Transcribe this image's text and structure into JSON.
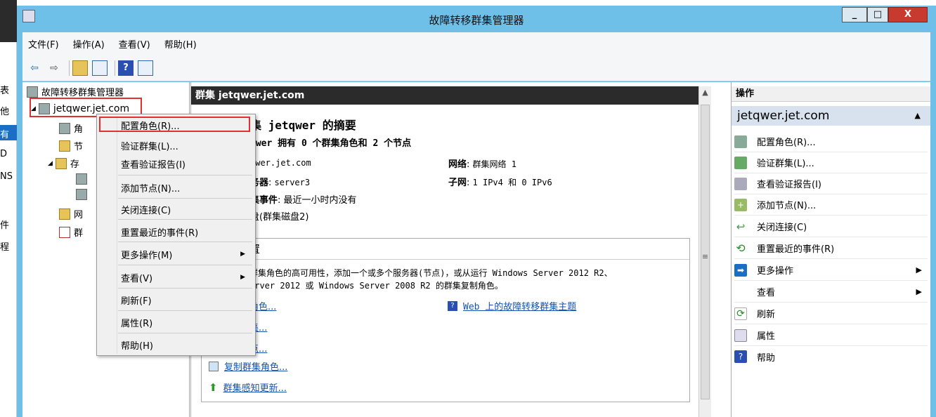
{
  "background": {
    "fragments": [
      "表",
      "他",
      "有",
      "D",
      "NS",
      "件",
      "程"
    ]
  },
  "window": {
    "title": "故障转移群集管理器",
    "min": "_",
    "max": "□",
    "close": "X"
  },
  "menu": [
    "文件(F)",
    "操作(A)",
    "查看(V)",
    "帮助(H)"
  ],
  "toolbar": {
    "back": "⇦",
    "forward": "⇨",
    "help": "?"
  },
  "tree": {
    "root": "故障转移群集管理器",
    "cluster": "jetqwer.jet.com",
    "children": [
      "角",
      "节",
      "存",
      "网",
      "群"
    ]
  },
  "center": {
    "header": "群集 jetqwer.jet.com",
    "summary_title": "集 jetqwer 的摘要",
    "summary_sub": "qwer 拥有 0 个群集角色和 2 个节点",
    "name_val": "qwer.jet.com",
    "server_key": "务器",
    "server_val": "server3",
    "network_key": "网络",
    "network_val": "群集网络 1",
    "subnet_key": "子网",
    "subnet_val": "1 IPv4 和 0 IPv6",
    "events_key": "集事件",
    "events_val": "最近一小时内没有",
    "disk": "盘(群集磁盘2)",
    "config_title": "置",
    "desc1": "群集角色的高可用性，添加一个或多个服务器(节点)，或从运行 Windows Server 2012 R2、",
    "desc2": "erver 2012 或 Windows Server 2008 R2 的群集复制角色。",
    "link1": "角色...",
    "link2": "集...",
    "link3": "点...",
    "link4": "复制群集角色...",
    "link5": "群集感知更新...",
    "web_link": "Web 上的故障转移群集主题"
  },
  "context_menu": [
    "配置角色(R)...",
    "验证群集(L)...",
    "查看验证报告(I)",
    "添加节点(N)...",
    "关闭连接(C)",
    "重置最近的事件(R)",
    "更多操作(M)",
    "查看(V)",
    "刷新(F)",
    "属性(R)",
    "帮助(H)"
  ],
  "actions": {
    "header": "操作",
    "sub": "jetqwer.jet.com",
    "items": [
      "配置角色(R)...",
      "验证群集(L)...",
      "查看验证报告(I)",
      "添加节点(N)...",
      "关闭连接(C)",
      "重置最近的事件(R)",
      "更多操作",
      "查看",
      "刷新",
      "属性",
      "帮助"
    ]
  },
  "colors": {
    "title_bar": "#6fc0e8",
    "highlight_box": "#e03030",
    "link": "#1552b0",
    "header_dark": "#2b2b2b"
  }
}
